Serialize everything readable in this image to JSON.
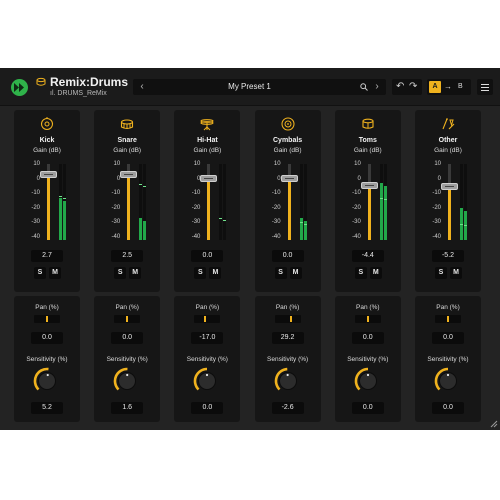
{
  "app": {
    "title": "Remix:Drums",
    "subtitle": "DRUMS_ReMix",
    "preset": "My Preset 1",
    "ab_a": "A",
    "ab_arrow": "→",
    "ab_b": "B",
    "accent": "#f0b21e",
    "meter_color": "#22a84a"
  },
  "icons": {
    "play": "play-forward-icon",
    "drum": "drum-icon",
    "prev": "chevron-left-icon",
    "next": "chevron-right-icon",
    "search": "search-icon",
    "undo": "undo-icon",
    "redo": "redo-icon",
    "menu": "hamburger-menu-icon"
  },
  "labels": {
    "gain": "Gain (dB)",
    "pan": "Pan (%)",
    "sensitivity": "Sensitivity (%)",
    "solo": "S",
    "mute": "M"
  },
  "scale": [
    "10",
    "0",
    "-10",
    "-20",
    "-30",
    "-40"
  ],
  "channels": [
    {
      "name": "Kick",
      "icon": "kick-drum-icon",
      "gain": "2.7",
      "gain_db": 2.7,
      "pan": "0.0",
      "pan_pct": 0,
      "sens": "5.2",
      "sens_pct": 5.2,
      "meter_db": -13,
      "peak_db": -12
    },
    {
      "name": "Snare",
      "icon": "snare-drum-icon",
      "gain": "2.5",
      "gain_db": 2.5,
      "pan": "0.0",
      "pan_pct": 0,
      "sens": "1.6",
      "sens_pct": 1.6,
      "meter_db": -27,
      "peak_db": -4
    },
    {
      "name": "Hi-Hat",
      "icon": "hi-hat-icon",
      "gain": "0.0",
      "gain_db": 0.0,
      "pan": "-17.0",
      "pan_pct": -17,
      "sens": "0.0",
      "sens_pct": 0,
      "meter_db": -50,
      "peak_db": -27
    },
    {
      "name": "Cymbals",
      "icon": "cymbal-icon",
      "gain": "0.0",
      "gain_db": 0.0,
      "pan": "29.2",
      "pan_pct": 29.2,
      "sens": "-2.6",
      "sens_pct": -2.6,
      "meter_db": -27,
      "peak_db": -30
    },
    {
      "name": "Toms",
      "icon": "tom-drum-icon",
      "gain": "-4.4",
      "gain_db": -4.4,
      "pan": "0.0",
      "pan_pct": 0,
      "sens": "0.0",
      "sens_pct": 0,
      "meter_db": -3,
      "peak_db": -13
    },
    {
      "name": "Other",
      "icon": "percussion-icon",
      "gain": "-5.2",
      "gain_db": -5.2,
      "pan": "0.0",
      "pan_pct": 0,
      "sens": "0.0",
      "sens_pct": 0,
      "meter_db": -20,
      "peak_db": -31
    }
  ]
}
